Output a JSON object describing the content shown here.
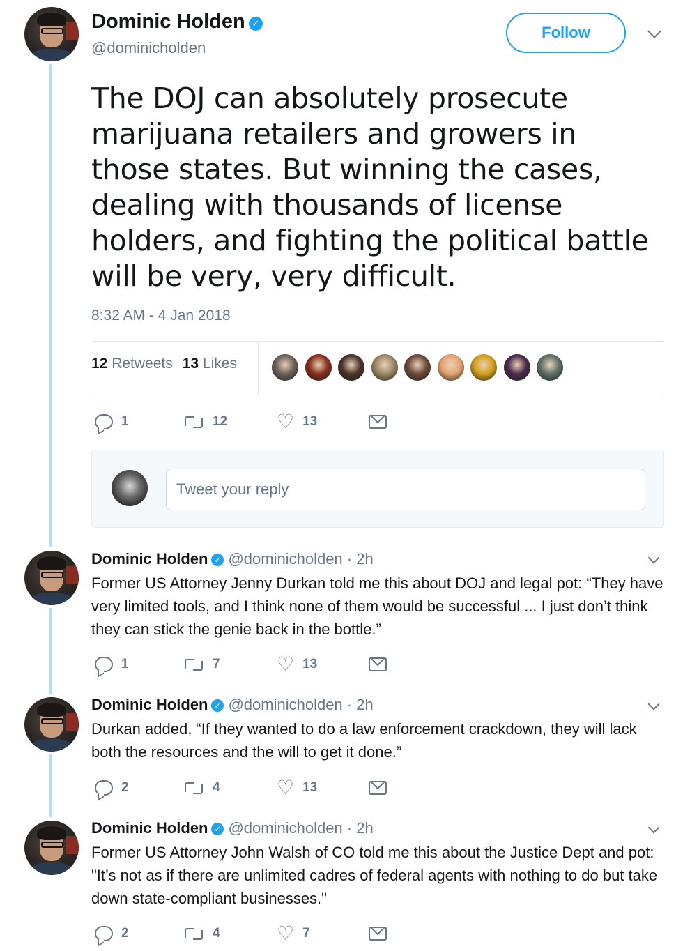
{
  "main_tweet": {
    "name": "Dominic Holden",
    "handle": "@dominicholden",
    "follow_label": "Follow",
    "text": "The DOJ can absolutely prosecute marijuana retailers and growers in those states. But winning the cases, dealing with thousands of license holders, and fighting the political battle will be very, very difficult.",
    "timestamp": "8:32 AM - 4 Jan 2018",
    "retweets_count": "12",
    "retweets_label": "Retweets",
    "likes_count": "13",
    "likes_label": "Likes",
    "liker_colors": [
      "#6d6058",
      "#8a2f1c",
      "#4a3426",
      "#9c8a66",
      "#6b4a38",
      "#e6a572",
      "#d4a017",
      "#4a2a4a",
      "#5d7066"
    ],
    "actions": {
      "reply": "1",
      "retweet": "12",
      "like": "13"
    }
  },
  "reply_box": {
    "placeholder": "Tweet your reply"
  },
  "replies": [
    {
      "name": "Dominic Holden",
      "handle": "@dominicholden · 2h",
      "text": "Former US Attorney Jenny Durkan told me this about DOJ and legal pot: “They have very limited tools, and I think none of them would be successful ... I just don’t think they can stick the genie back in the bottle.”",
      "reply": "1",
      "retweet": "7",
      "like": "13"
    },
    {
      "name": "Dominic Holden",
      "handle": "@dominicholden · 2h",
      "text": "Durkan added, “If they wanted to do a law enforcement crackdown, they will lack both the resources and the will to get it done.”",
      "reply": "2",
      "retweet": "4",
      "like": "13"
    },
    {
      "name": "Dominic Holden",
      "handle": "@dominicholden · 2h",
      "text": "Former US Attorney John Walsh of CO told me this about the Justice Dept and pot: \"It’s not as if there are unlimited cadres of federal agents with nothing to do but take down state-compliant businesses.\"",
      "reply": "2",
      "retweet": "4",
      "like": "7"
    }
  ]
}
